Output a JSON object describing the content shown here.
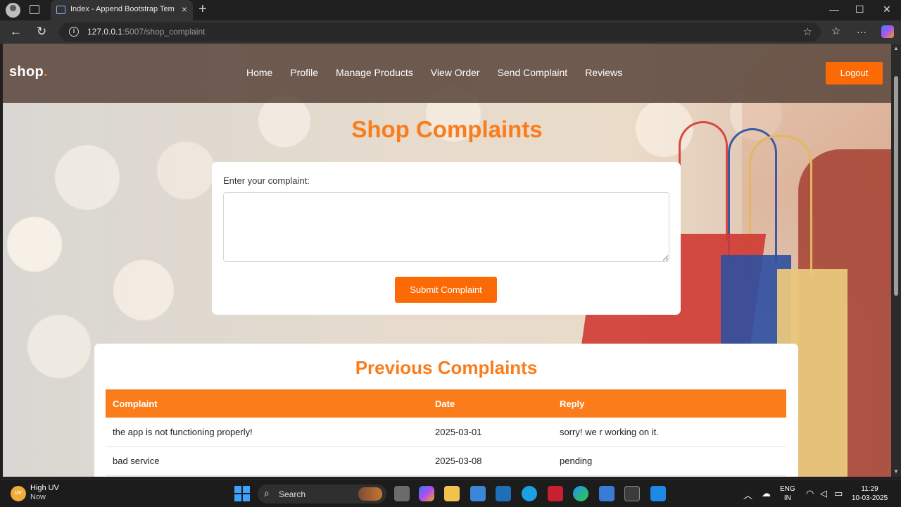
{
  "browser": {
    "tab_title": "Index - Append Bootstrap Template",
    "tab_close": "×",
    "new_tab": "+",
    "url_host": "127.0.0.1",
    "url_rest": ":5007/shop_complaint",
    "window": {
      "minimize": "—",
      "maximize": "☐",
      "close": "✕"
    },
    "nav": {
      "back": "←",
      "reload": "↻",
      "star": "☆",
      "favorites": "☆",
      "more": "···"
    }
  },
  "site": {
    "brand": "shop",
    "brand_dot": ".",
    "nav": [
      "Home",
      "Profile",
      "Manage Products",
      "View Order",
      "Send Complaint",
      "Reviews"
    ],
    "logout_label": "Logout"
  },
  "complaint_form": {
    "title": "Shop Complaints",
    "label": "Enter your complaint:",
    "value": "",
    "submit_label": "Submit Complaint"
  },
  "previous": {
    "title": "Previous Complaints",
    "columns": [
      "Complaint",
      "Date",
      "Reply"
    ],
    "rows": [
      [
        "the app is not functioning properly!",
        "2025-03-01",
        "sorry! we r working on it."
      ],
      [
        "bad service",
        "2025-03-08",
        "pending"
      ]
    ]
  },
  "taskbar": {
    "weather_badge": "UV",
    "weather_title": "High UV",
    "weather_sub": "Now",
    "search_label": "Search",
    "lang_top": "ENG",
    "lang_bottom": "IN",
    "time": "11:29",
    "date": "10-03-2025"
  },
  "colors": {
    "accent": "#fa7c1b",
    "button": "#fb6a05"
  }
}
